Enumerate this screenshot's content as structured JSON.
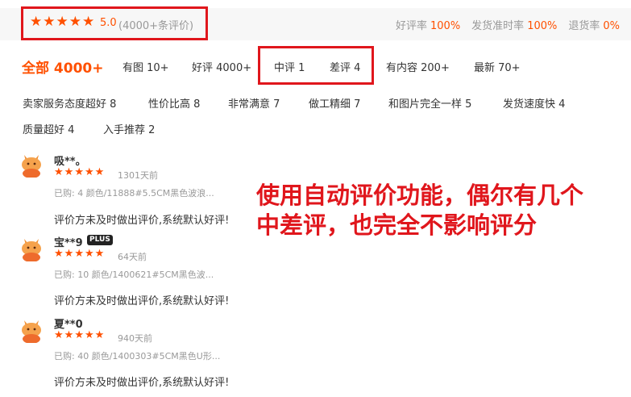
{
  "summary": {
    "rating_score": "5.0",
    "rating_count": "(4000+条评价)",
    "star_icon": "star-icon",
    "metrics": [
      {
        "label": "好评率",
        "value": "100%"
      },
      {
        "label": "发货准时率",
        "value": "100%"
      },
      {
        "label": "退货率",
        "value": "0%"
      }
    ]
  },
  "tabs": [
    {
      "label": "全部 4000+"
    },
    {
      "label": "有图 10+"
    },
    {
      "label": "好评 4000+"
    },
    {
      "label": "中评 1"
    },
    {
      "label": "差评 4"
    },
    {
      "label": "有内容 200+"
    },
    {
      "label": "最新 70+"
    }
  ],
  "tags": [
    "卖家服务态度超好 8",
    "性价比高 8",
    "非常满意 7",
    "做工精细 7",
    "和图片完全一样 5",
    "发货速度快 4",
    "质量超好 4",
    "入手推荐 2"
  ],
  "reviews": [
    {
      "user": "吸**。",
      "rating": 5,
      "date": "1301天前",
      "sku": "已购: 4 颜色/11888#5.5CM黑色波浪...",
      "text": "评价方未及时做出评价,系统默认好评!"
    },
    {
      "user": "宝**9",
      "badge": "PLUS",
      "rating": 5,
      "date": "64天前",
      "sku": "已购: 10 颜色/1400621#5CM黑色波...",
      "text": "评价方未及时做出评价,系统默认好评!"
    },
    {
      "user": "夏**0",
      "rating": 5,
      "date": "940天前",
      "sku": "已购: 40 颜色/1400303#5CM黑色U形...",
      "text": "评价方未及时做出评价,系统默认好评!"
    }
  ],
  "annotation": {
    "line1": "使用自动评价功能，偶尔有几个",
    "line2": "中差评，也完全不影响评分"
  },
  "colors": {
    "accent": "#ff5000",
    "highlight_box": "#e0161c",
    "muted": "#999999"
  }
}
